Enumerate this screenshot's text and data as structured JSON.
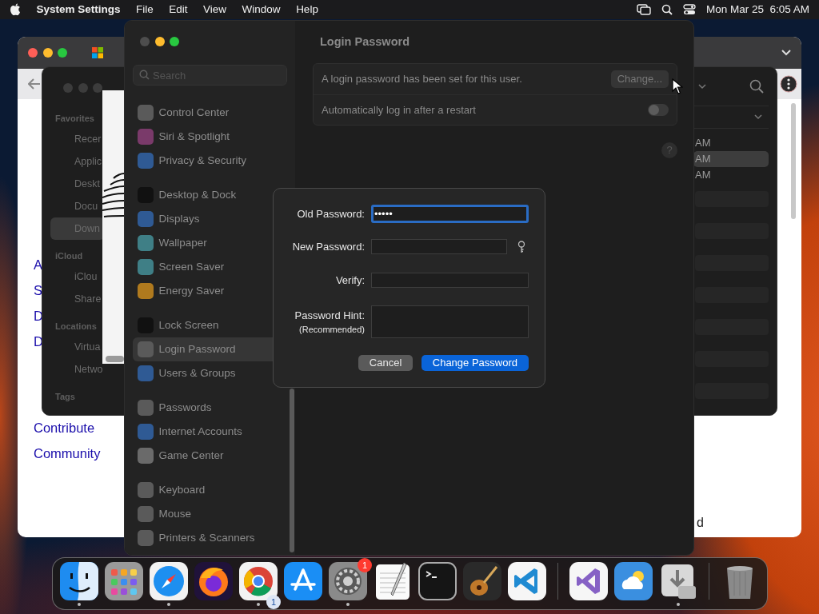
{
  "menu_bar": {
    "app": "System Settings",
    "menus": [
      "File",
      "Edit",
      "View",
      "Window",
      "Help"
    ],
    "clock": "Mon Mar 25  6:05 AM"
  },
  "browser_window": {
    "links": [
      "A",
      "S",
      "D",
      "D"
    ],
    "footer_links": [
      "Contribute",
      "Community"
    ],
    "footer_text": "d"
  },
  "finder_window": {
    "sections": [
      {
        "title": "Favorites",
        "items": [
          {
            "label": "Recer",
            "selected": false
          },
          {
            "label": "Applic",
            "selected": false
          },
          {
            "label": "Deskt",
            "selected": false
          },
          {
            "label": "Docu",
            "selected": false
          },
          {
            "label": "Down",
            "selected": true
          }
        ]
      },
      {
        "title": "iCloud",
        "items": [
          {
            "label": "iClou",
            "selected": false
          },
          {
            "label": "Share",
            "selected": false
          }
        ]
      },
      {
        "title": "Locations",
        "items": [
          {
            "label": "Virtua",
            "selected": false
          },
          {
            "label": "Netwo",
            "selected": false
          }
        ]
      },
      {
        "title": "Tags"
      }
    ],
    "rows": [
      {
        "time": "AM",
        "selected": false
      },
      {
        "time": "AM",
        "selected": true
      },
      {
        "time": "AM",
        "selected": false
      }
    ]
  },
  "settings": {
    "search": {
      "placeholder": "Search"
    },
    "sidebar": [
      [
        {
          "label": "Control Center",
          "color": "#5a5a5a",
          "selected": false
        },
        {
          "label": "Siri & Spotlight",
          "color": "#7a3a6a",
          "selected": false
        },
        {
          "label": "Privacy & Security",
          "color": "#2f5a94",
          "selected": false
        }
      ],
      [
        {
          "label": "Desktop & Dock",
          "color": "#111111",
          "selected": false
        },
        {
          "label": "Displays",
          "color": "#2f5a94",
          "selected": false
        },
        {
          "label": "Wallpaper",
          "color": "#3f7f86",
          "selected": false
        },
        {
          "label": "Screen Saver",
          "color": "#3f7f86",
          "selected": false
        },
        {
          "label": "Energy Saver",
          "color": "#b07a1e",
          "selected": false
        }
      ],
      [
        {
          "label": "Lock Screen",
          "color": "#111111",
          "selected": false
        },
        {
          "label": "Login Password",
          "color": "#5a5a5a",
          "selected": true
        },
        {
          "label": "Users & Groups",
          "color": "#2f5a94",
          "selected": false
        }
      ],
      [
        {
          "label": "Passwords",
          "color": "#5a5a5a",
          "selected": false
        },
        {
          "label": "Internet Accounts",
          "color": "#2f5a94",
          "selected": false
        },
        {
          "label": "Game Center",
          "color": "#6a6a6a",
          "selected": false
        }
      ],
      [
        {
          "label": "Keyboard",
          "color": "#5a5a5a",
          "selected": false
        },
        {
          "label": "Mouse",
          "color": "#5a5a5a",
          "selected": false
        },
        {
          "label": "Printers & Scanners",
          "color": "#5a5a5a",
          "selected": false
        }
      ]
    ],
    "title": "Login Password",
    "rows": [
      {
        "kind": "button",
        "label": "A login password has been set for this user.",
        "button": "Change..."
      },
      {
        "kind": "toggle",
        "label": "Automatically log in after a restart",
        "on": false
      }
    ],
    "help": "?"
  },
  "dialog": {
    "fields": [
      {
        "label": "Old Password:",
        "value": "•••••",
        "focused": true,
        "key_button": false
      },
      {
        "label": "New Password:",
        "focused": false,
        "key_button": true
      },
      {
        "label": "Verify:",
        "focused": false,
        "key_button": false
      }
    ],
    "hint": {
      "label": "Password Hint:",
      "sublabel": "(Recommended)"
    },
    "buttons": [
      {
        "label": "Cancel",
        "default": false
      },
      {
        "label": "Change Password",
        "default": true
      }
    ]
  },
  "dock": {
    "apps": [
      {
        "kind": "finder",
        "running": true
      },
      {
        "kind": "launchpad",
        "running": false
      },
      {
        "kind": "safari",
        "running": true
      },
      {
        "kind": "firefox",
        "running": false
      },
      {
        "kind": "chrome",
        "running": true,
        "badge": "1"
      },
      {
        "kind": "appstore",
        "running": false
      },
      {
        "kind": "settings",
        "running": true,
        "badge": "1"
      },
      {
        "kind": "notes",
        "running": false
      },
      {
        "kind": "terminal",
        "running": false
      },
      {
        "kind": "guitar",
        "running": false
      },
      {
        "kind": "vscode",
        "running": false
      },
      {
        "kind": "separator"
      },
      {
        "kind": "vs",
        "running": false
      },
      {
        "kind": "weather",
        "running": false
      },
      {
        "kind": "downloads",
        "running": true
      },
      {
        "kind": "separator"
      },
      {
        "kind": "trash",
        "running": false
      }
    ]
  }
}
